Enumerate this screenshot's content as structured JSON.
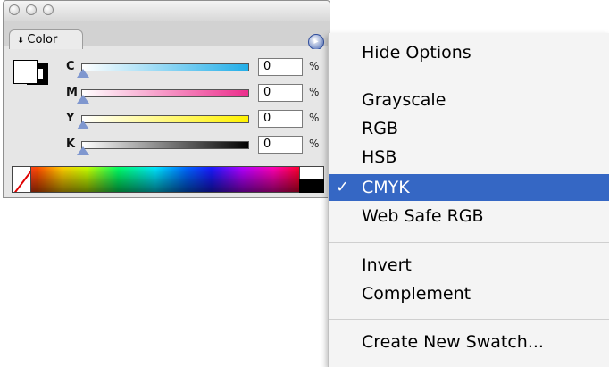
{
  "panel": {
    "tab_label": "Color",
    "swatch": {
      "fill": "#ffffff",
      "stroke": "#000000"
    },
    "sliders": [
      {
        "label": "C",
        "value": "0",
        "unit": "%"
      },
      {
        "label": "M",
        "value": "0",
        "unit": "%"
      },
      {
        "label": "Y",
        "value": "0",
        "unit": "%"
      },
      {
        "label": "K",
        "value": "0",
        "unit": "%"
      }
    ]
  },
  "menu": {
    "items": [
      {
        "label": "Hide Options"
      },
      {
        "label": "Grayscale"
      },
      {
        "label": "RGB"
      },
      {
        "label": "HSB"
      },
      {
        "label": "CMYK",
        "checked": true
      },
      {
        "label": "Web Safe RGB"
      },
      {
        "label": "Invert"
      },
      {
        "label": "Complement"
      },
      {
        "label": "Create New Swatch..."
      }
    ],
    "check_mark": "✓",
    "selected_color": "#3567c4"
  },
  "icons": {
    "tab_diamond": "⬍",
    "options_button": "▸"
  }
}
